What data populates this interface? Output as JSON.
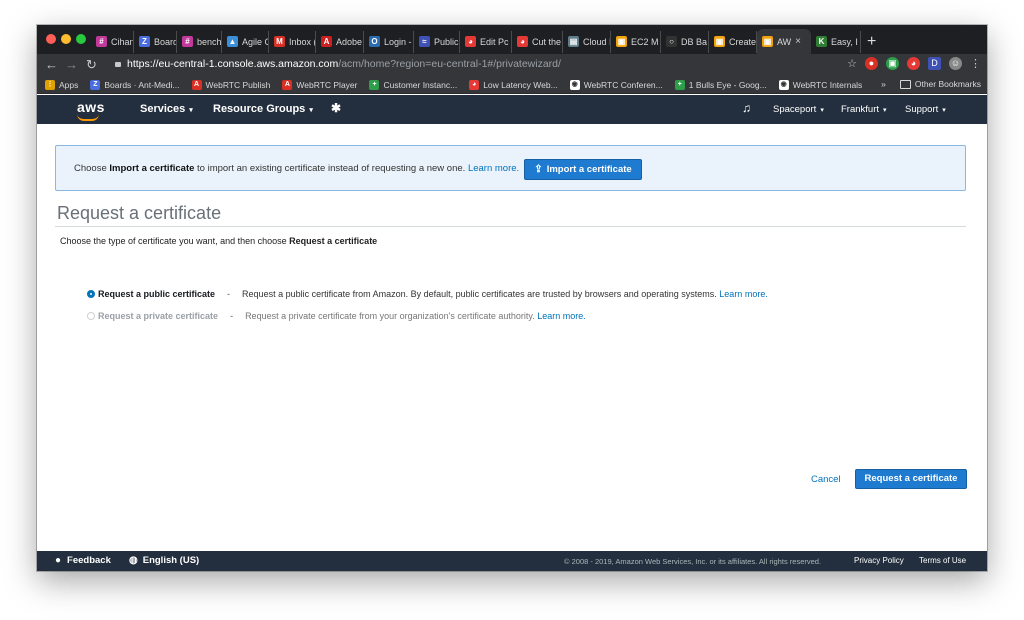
{
  "browser": {
    "tabs": [
      {
        "label": "Cihan",
        "color": "#c0399b",
        "glyph": "#"
      },
      {
        "label": "Board",
        "color": "#4a6ee0",
        "glyph": "Z"
      },
      {
        "label": "benchr",
        "color": "#c0399b",
        "glyph": "#"
      },
      {
        "label": "Agile C",
        "color": "#3b8fd9",
        "glyph": "▲"
      },
      {
        "label": "Inbox (",
        "color": "#d93025",
        "glyph": "M"
      },
      {
        "label": "Adobe",
        "color": "#cc1f1f",
        "glyph": "A"
      },
      {
        "label": "Login -",
        "color": "#2b6cb0",
        "glyph": "O"
      },
      {
        "label": "Public",
        "color": "#3f51b5",
        "glyph": "≈"
      },
      {
        "label": "Edit Pc",
        "color": "#e53935",
        "glyph": "◕"
      },
      {
        "label": "Cut the",
        "color": "#e53935",
        "glyph": "◕"
      },
      {
        "label": "Cloud I",
        "color": "#607d8b",
        "glyph": "▤"
      },
      {
        "label": "EC2 M",
        "color": "#f0a30a",
        "glyph": "▣"
      },
      {
        "label": "DB Ba",
        "color": "#333333",
        "glyph": "○"
      },
      {
        "label": "Create",
        "color": "#f0a30a",
        "glyph": "▣"
      },
      {
        "label": "AW",
        "color": "#f0a30a",
        "glyph": "▣"
      },
      {
        "label": "Easy, I",
        "color": "#2e7d32",
        "glyph": "K"
      }
    ],
    "active_tab_index": 14,
    "url_host": "https://eu-central-1.console.aws.amazon.com",
    "url_path": "/acm/home?region=eu-central-1#/privatewizard/",
    "bookmarks": [
      {
        "label": "Apps",
        "color": "#e0a100",
        "glyph": "⋮"
      },
      {
        "label": "Boards · Ant-Medi...",
        "color": "#4a6ee0",
        "glyph": "Z"
      },
      {
        "label": "WebRTC Publish",
        "color": "#d93025",
        "glyph": "A"
      },
      {
        "label": "WebRTC Player",
        "color": "#d93025",
        "glyph": "A"
      },
      {
        "label": "Customer Instanc...",
        "color": "#2e9e4a",
        "glyph": "+"
      },
      {
        "label": "Low Latency Web...",
        "color": "#e53935",
        "glyph": "◕"
      },
      {
        "label": "WebRTC Conferen...",
        "color": "#ffffff",
        "glyph": "◉"
      },
      {
        "label": "1 Bulls Eye - Goog...",
        "color": "#2e9e4a",
        "glyph": "+"
      },
      {
        "label": "WebRTC Internals",
        "color": "#ffffff",
        "glyph": "◉"
      }
    ],
    "bookmarks_overflow": "»",
    "other_bookmarks": "Other Bookmarks"
  },
  "aws_nav": {
    "logo": "aws",
    "services": "Services",
    "resource_groups": "Resource Groups",
    "account": "Spaceport",
    "region": "Frankfurt",
    "support": "Support"
  },
  "info_box": {
    "prefix": "Choose ",
    "bold": "Import a certificate",
    "suffix": " to import an existing certificate instead of requesting a new one. ",
    "learn_more": "Learn more.",
    "button": "Import a certificate"
  },
  "page": {
    "title": "Request a certificate",
    "instructions_prefix": "Choose the type of certificate you want, and then choose ",
    "instructions_bold": "Request a certificate"
  },
  "options": [
    {
      "label": "Request a public certificate",
      "desc": "Request a public certificate from Amazon. By default, public certificates are trusted by browsers and operating systems.",
      "learn_more": "Learn more.",
      "selected": true
    },
    {
      "label": "Request a private certificate",
      "desc": "Request a private certificate from your organization's certificate authority.",
      "learn_more": "Learn more.",
      "selected": false
    }
  ],
  "actions": {
    "cancel": "Cancel",
    "submit": "Request a certificate"
  },
  "footer": {
    "feedback": "Feedback",
    "language": "English (US)",
    "copyright": "© 2008 - 2019, Amazon Web Services, Inc. or its affiliates. All rights reserved.",
    "privacy": "Privacy Policy",
    "terms": "Terms of Use"
  },
  "colors": {
    "aws_navy": "#232f3e",
    "aws_orange": "#ff9900",
    "primary_blue": "#1f7bd0",
    "link_blue": "#0073bb",
    "info_bg": "#eaf3fb"
  }
}
